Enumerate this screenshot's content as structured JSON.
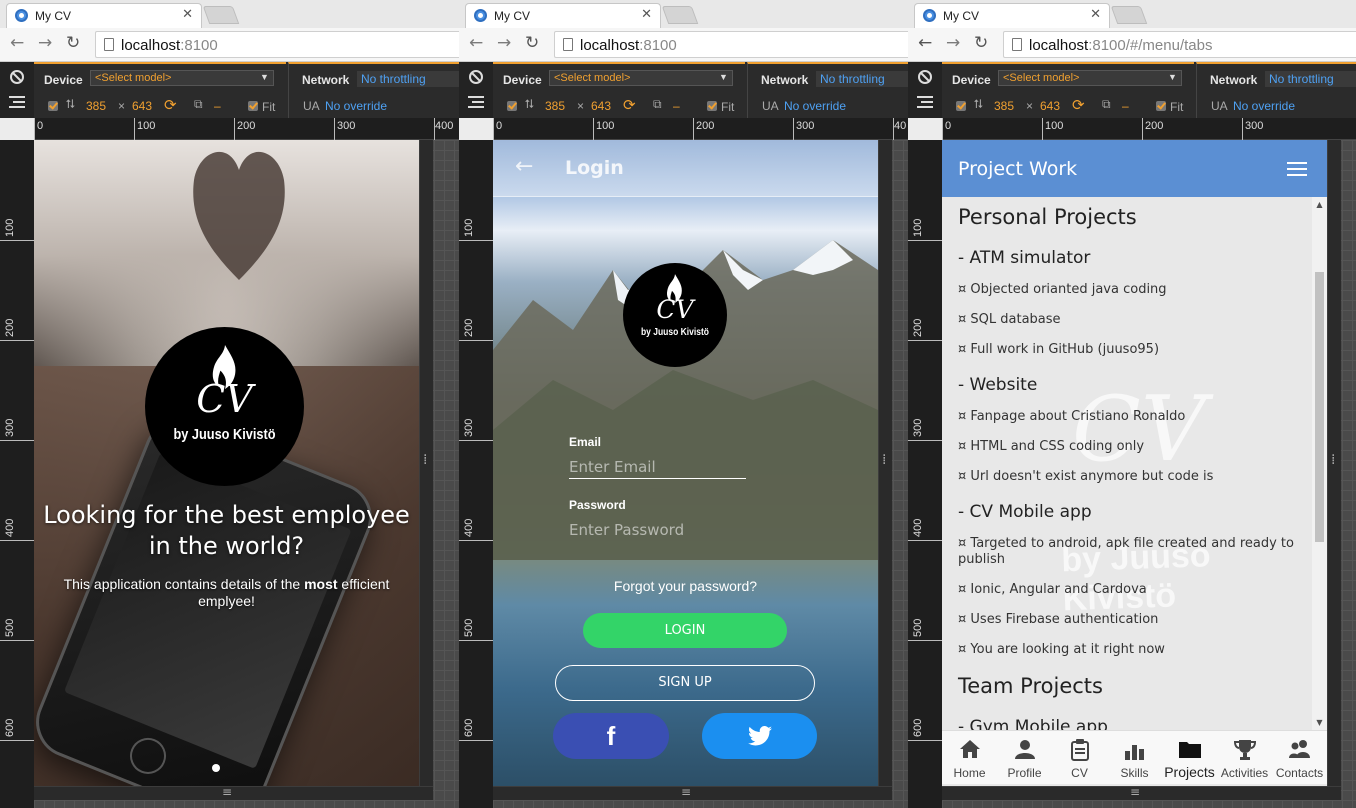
{
  "windows": [
    {
      "tab_title": "My CV",
      "url_host": "localhost",
      "url_rest": ":8100",
      "device": {
        "label": "Device",
        "model": "<Select model>",
        "width": "385",
        "x": "×",
        "height": "643",
        "dash": "–",
        "fit": "Fit"
      },
      "network": {
        "label": "Network",
        "value": "No throttling",
        "ua_label": "UA",
        "ua_value": "No override"
      },
      "ruler_x": [
        "0",
        "100",
        "200",
        "300",
        "400"
      ],
      "ruler_y": [
        "100",
        "200",
        "300",
        "400",
        "500",
        "600"
      ]
    },
    {
      "tab_title": "My CV",
      "url_host": "localhost",
      "url_rest": ":8100",
      "device": {
        "label": "Device",
        "model": "<Select model>",
        "width": "385",
        "x": "×",
        "height": "643",
        "dash": "–",
        "fit": "Fit"
      },
      "network": {
        "label": "Network",
        "value": "No throttling",
        "ua_label": "UA",
        "ua_value": "No override"
      },
      "ruler_x": [
        "0",
        "100",
        "200",
        "300",
        "40"
      ],
      "ruler_y": [
        "100",
        "200",
        "300",
        "400",
        "500",
        "600"
      ]
    },
    {
      "tab_title": "My CV",
      "url_host": "localhost",
      "url_rest": ":8100/#/menu/tabs",
      "device": {
        "label": "Device",
        "model": "<Select model>",
        "width": "385",
        "x": "×",
        "height": "643",
        "dash": "–",
        "fit": "Fit"
      },
      "network": {
        "label": "Network",
        "value": "No throttling",
        "ua_label": "UA",
        "ua_value": "No override"
      },
      "ruler_x": [
        "0",
        "100",
        "200",
        "300"
      ],
      "ruler_y": [
        "100",
        "200",
        "300",
        "400",
        "500",
        "600"
      ]
    }
  ],
  "screen1": {
    "logo_cv": "CV",
    "logo_by": "by Juuso Kivistö",
    "headline": "Looking for the best employee in the world?",
    "sub_pre": "This application contains details of the ",
    "sub_bold": "most",
    "sub_post": " efficient emplyee!"
  },
  "screen2": {
    "title": "Login",
    "logo_cv": "CV",
    "logo_by": "by Juuso Kivistö",
    "email_label": "Email",
    "email_placeholder": "Enter Email",
    "password_label": "Password",
    "password_placeholder": "Enter Password",
    "forgot": "Forgot your password?",
    "login_btn": "LOGIN",
    "signup_btn": "SIGN UP",
    "fb_btn": "f"
  },
  "screen3": {
    "title": "Project Work",
    "watermark_cv": "CV",
    "watermark_by": "by Juuso Kivistö",
    "personal_heading": "Personal Projects",
    "projects": [
      {
        "name": "- ATM simulator",
        "items": [
          "¤ Objected orianted java coding",
          "¤ SQL database",
          "¤ Full work in GitHub (juuso95)"
        ]
      },
      {
        "name": "- Website",
        "items": [
          "¤ Fanpage about Cristiano Ronaldo",
          "¤ HTML and CSS coding only",
          "¤ Url doesn't exist anymore but code is"
        ]
      },
      {
        "name": "- CV Mobile app",
        "items": [
          "¤ Targeted to android, apk file created and ready to publish",
          "¤ Ionic, Angular and Cardova",
          "¤ Uses Firebase authentication",
          "¤ You are looking at it right now"
        ]
      }
    ],
    "team_heading": "Team Projects",
    "team_first": "- Gym Mobile app",
    "tabs": [
      {
        "label": "Home",
        "icon": "home-icon"
      },
      {
        "label": "Profile",
        "icon": "person-icon"
      },
      {
        "label": "CV",
        "icon": "clipboard-icon"
      },
      {
        "label": "Skills",
        "icon": "bar-chart-icon"
      },
      {
        "label": "Projects",
        "icon": "folder-icon",
        "active": true
      },
      {
        "label": "Activities",
        "icon": "trophy-icon"
      },
      {
        "label": "Contacts",
        "icon": "contacts-icon"
      }
    ],
    "accent": "#5b8fd3"
  }
}
